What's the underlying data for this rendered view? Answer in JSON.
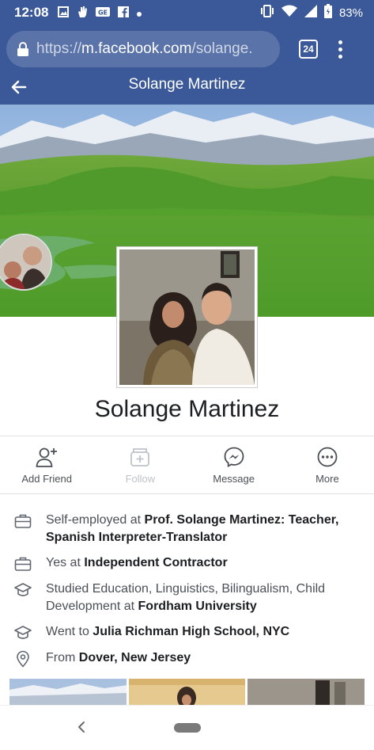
{
  "status_bar": {
    "time": "12:08",
    "battery": "83%",
    "left_icons": [
      "image-icon",
      "hand-icon",
      "ge-icon",
      "facebook-icon",
      "dot-icon"
    ],
    "right_icons": [
      "vibrate-icon",
      "wifi-icon",
      "signal-icon",
      "battery-icon"
    ]
  },
  "browser": {
    "url_scheme": "https://",
    "url_host": "m.facebook.com",
    "url_path": "/solange.",
    "tab_count": "24"
  },
  "header": {
    "title": "Solange Martinez"
  },
  "profile": {
    "name": "Solange Martinez"
  },
  "actions": [
    {
      "label": "Add Friend",
      "icon": "add-friend-icon",
      "enabled": true
    },
    {
      "label": "Follow",
      "icon": "follow-icon",
      "enabled": false
    },
    {
      "label": "Message",
      "icon": "messenger-icon",
      "enabled": true
    },
    {
      "label": "More",
      "icon": "more-icon",
      "enabled": true
    }
  ],
  "intro": {
    "work1": {
      "prefix": "Self-employed at ",
      "bold": "Prof. Solange Martinez: Teacher, Spanish Interpreter-Translator"
    },
    "work2": {
      "prefix": "Yes at ",
      "bold": "Independent Contractor"
    },
    "edu1": {
      "prefix": "Studied Education, Linguistics, Bilingualism, Child Development at ",
      "bold": "Fordham University"
    },
    "edu2": {
      "prefix": "Went to ",
      "bold": "Julia Richman High School, NYC"
    },
    "home": {
      "prefix": "From ",
      "bold": "Dover, New Jersey"
    }
  },
  "colors": {
    "brand": "#3b5998",
    "text": "#1c1e21",
    "secondary_text": "#4b4f56",
    "disabled": "#bec3c9"
  }
}
